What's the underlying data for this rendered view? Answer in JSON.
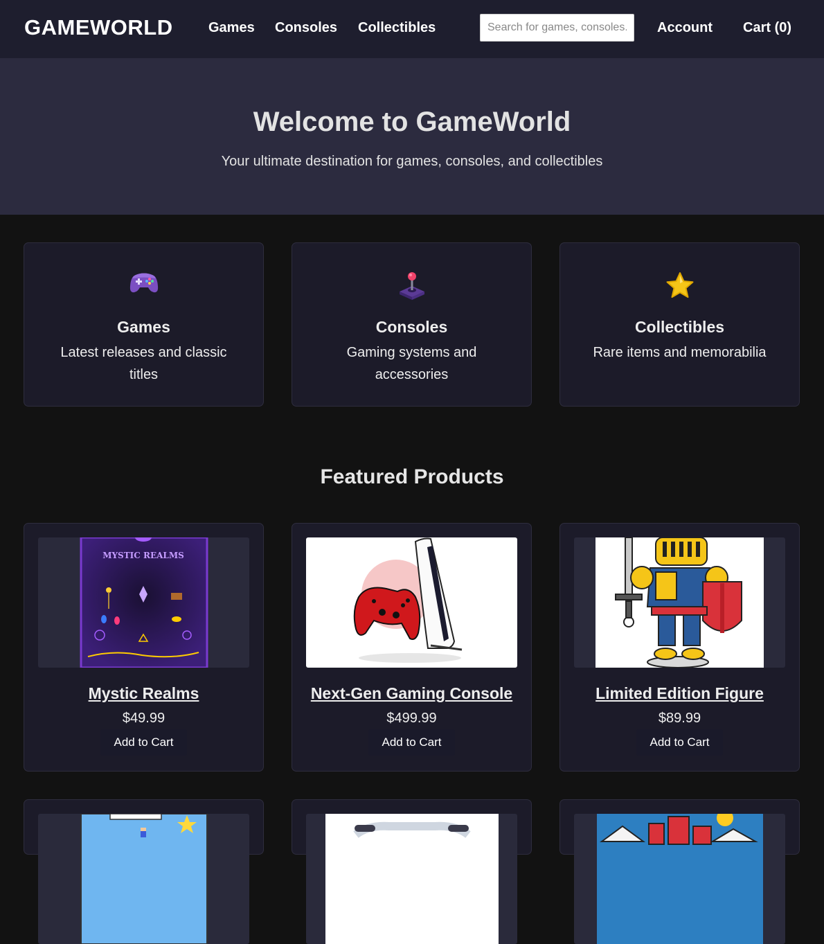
{
  "header": {
    "logo": "GAMEWORLD",
    "nav": [
      "Games",
      "Consoles",
      "Collectibles"
    ],
    "search_placeholder": "Search for games, consoles...",
    "account": "Account",
    "cart": "Cart (0)"
  },
  "hero": {
    "title": "Welcome to GameWorld",
    "subtitle": "Your ultimate destination for games, consoles, and collectibles"
  },
  "categories": [
    {
      "icon": "game-controller-icon",
      "title": "Games",
      "desc": "Latest releases and classic titles"
    },
    {
      "icon": "joystick-icon",
      "title": "Consoles",
      "desc": "Gaming systems and accessories"
    },
    {
      "icon": "star-icon",
      "title": "Collectibles",
      "desc": "Rare items and memorabilia"
    }
  ],
  "featured": {
    "title": "Featured Products",
    "products": [
      {
        "name": "Mystic Realms",
        "price": "$49.99",
        "button": "Add to Cart",
        "image_text": "MYSTIC REALMS"
      },
      {
        "name": "Next-Gen Gaming Console",
        "price": "$499.99",
        "button": "Add to Cart"
      },
      {
        "name": "Limited Edition Figure",
        "price": "$89.99",
        "button": "Add to Cart"
      }
    ]
  },
  "colors": {
    "header_bg": "#1e1e2e",
    "hero_bg": "#2c2b3f",
    "page_bg": "#121212",
    "card_bg": "#1c1b29"
  }
}
